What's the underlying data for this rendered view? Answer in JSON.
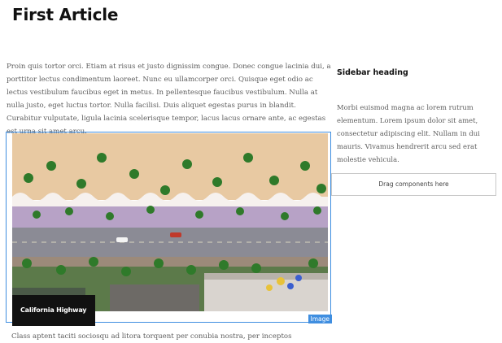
{
  "article": {
    "title": "First Article",
    "body": "Proin quis tortor orci. Etiam at risus et justo dignissim congue. Donec congue lacinia dui, a porttitor lectus condimentum laoreet. Nunc eu ullamcorper orci. Quisque eget odio ac lectus vestibulum faucibus eget in metus. In pellentesque faucibus vestibulum. Nulla at nulla justo, eget luctus tortor. Nulla facilisi. Duis aliquet egestas purus in blandit. Curabitur vulputate, ligula lacinia scelerisque tempor, lacus lacus ornare ante, ac egestas est urna sit amet arcu.",
    "image": {
      "caption": "California Highway",
      "component_tag": "Image"
    },
    "trailing_text": "Class aptent taciti sociosqu ad litora torquent per conubia nostra, per inceptos"
  },
  "sidebar": {
    "heading": "Sidebar heading",
    "text": "Morbi euismod magna ac lorem rutrum elementum. Lorem ipsum dolor sit amet, consectetur adipiscing elit. Nullam in dui mauris. Vivamus hendrerit arcu sed erat molestie vehicula.",
    "drop_zone_label": "Drag components here"
  },
  "colors": {
    "selection_accent": "#3f8ee0",
    "caption_background": "#111111"
  }
}
